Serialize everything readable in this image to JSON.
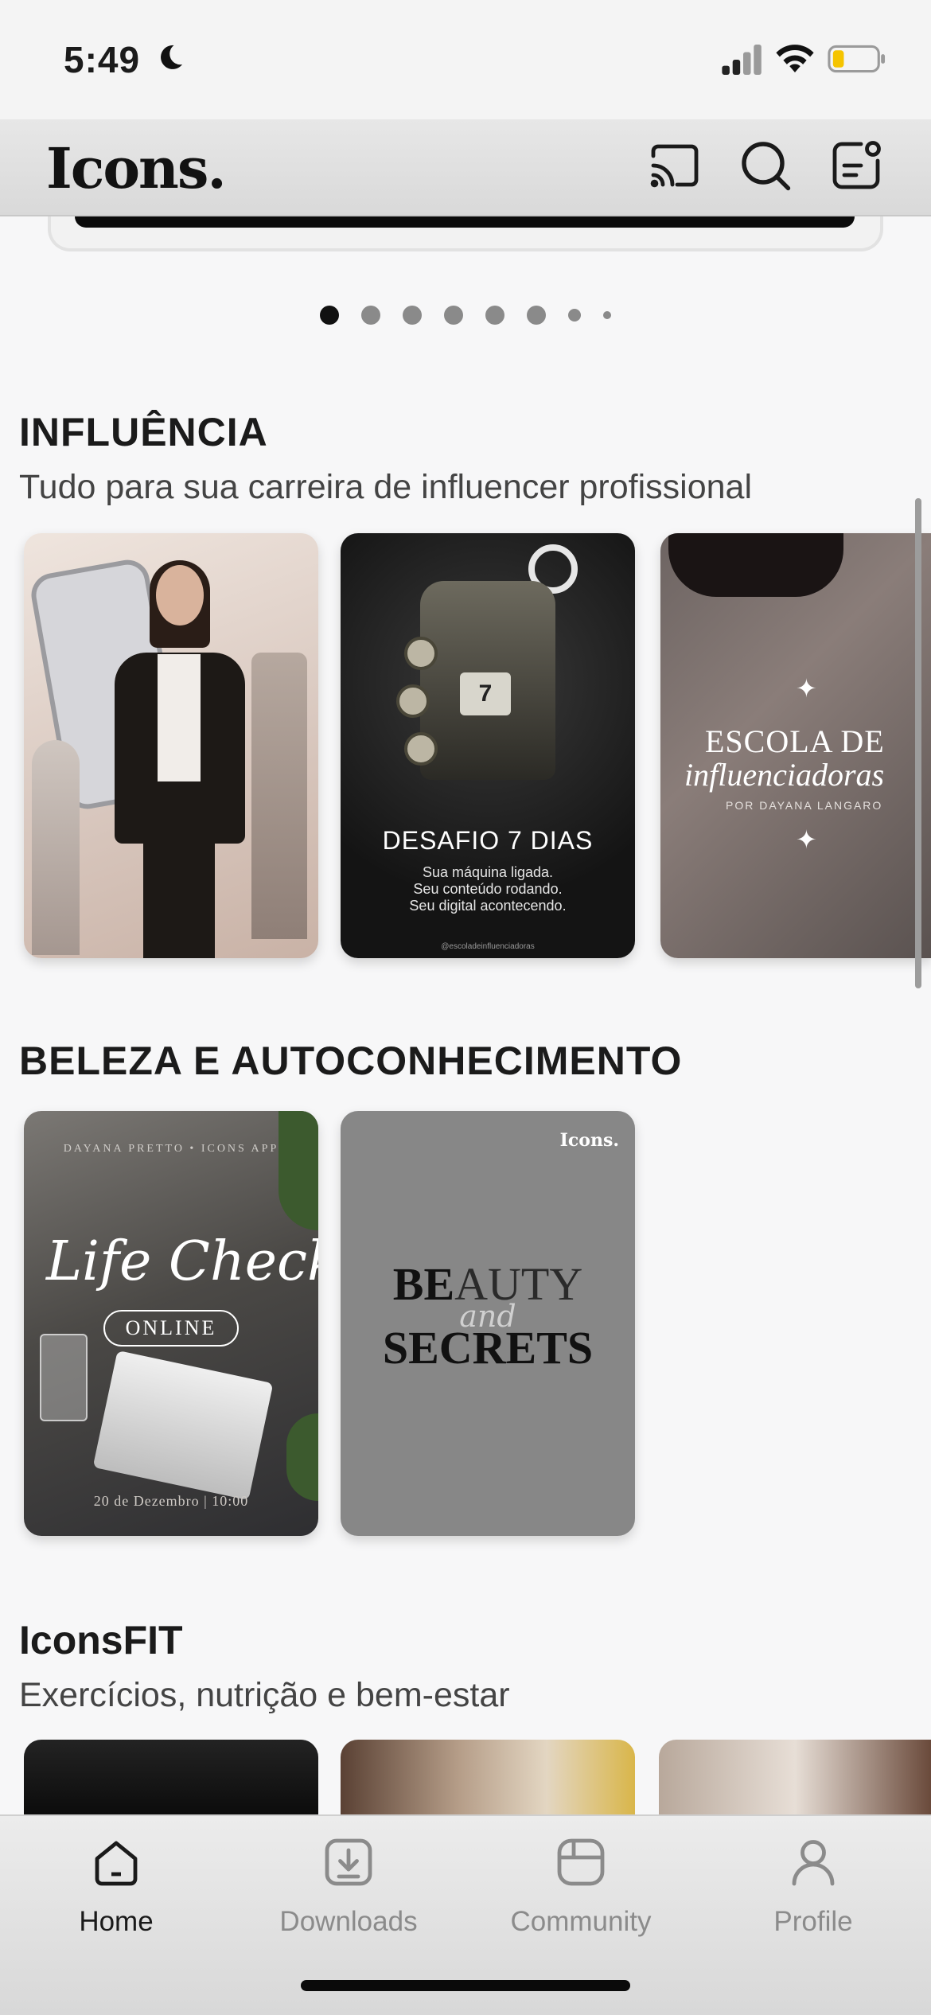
{
  "status_bar": {
    "time": "5:49",
    "icons": [
      "moon-icon",
      "signal-icon",
      "wifi-icon",
      "battery-icon"
    ]
  },
  "header": {
    "logo": "Icons.",
    "actions": [
      "cast-icon",
      "search-icon",
      "profile-badge-icon"
    ]
  },
  "carousel": {
    "dot_count": 8,
    "active_index": 0
  },
  "sections": [
    {
      "title": "INFLUÊNCIA",
      "subtitle": "Tudo para sua carreira de influencer profissional",
      "cards": [
        {
          "name": "influencer-card"
        },
        {
          "name": "desafio-card",
          "screen_number": "7",
          "title": "DESAFIO 7 DIAS",
          "line1": "Sua máquina ligada.",
          "line2": "Seu conteúdo rodando.",
          "line3": "Seu digital acontecendo.",
          "handle": "@escoladeinfluenciadoras"
        },
        {
          "name": "escola-card",
          "line1": "ESCOLA DE",
          "line2": "influenciadoras",
          "line3": "POR DAYANA LANGARO"
        }
      ]
    },
    {
      "title": "BELEZA E AUTOCONHECIMENTO",
      "cards": [
        {
          "name": "life-check-card",
          "top": "DAYANA PRETTO • ICONS APP",
          "script": "Life Check",
          "badge": "ONLINE",
          "date": "20 de Dezembro | 10:00"
        },
        {
          "name": "beauty-secrets-card",
          "logo": "Icons.",
          "line1_bold": "BE",
          "line1_light": "AUTY",
          "and": "and",
          "line2": "SECRETS"
        }
      ]
    },
    {
      "title": "IconsFIT",
      "subtitle": "Exercícios, nutrição e bem-estar"
    }
  ],
  "tabs": [
    {
      "label": "Home",
      "icon": "home-icon",
      "active": true
    },
    {
      "label": "Downloads",
      "icon": "download-icon",
      "active": false
    },
    {
      "label": "Community",
      "icon": "community-icon",
      "active": false
    },
    {
      "label": "Profile",
      "icon": "user-icon",
      "active": false
    }
  ],
  "colors": {
    "background": "#f7f7f8",
    "text": "#1b1b1b",
    "tab_inactive": "#8b8b8b",
    "beauty_card": "#878787"
  }
}
